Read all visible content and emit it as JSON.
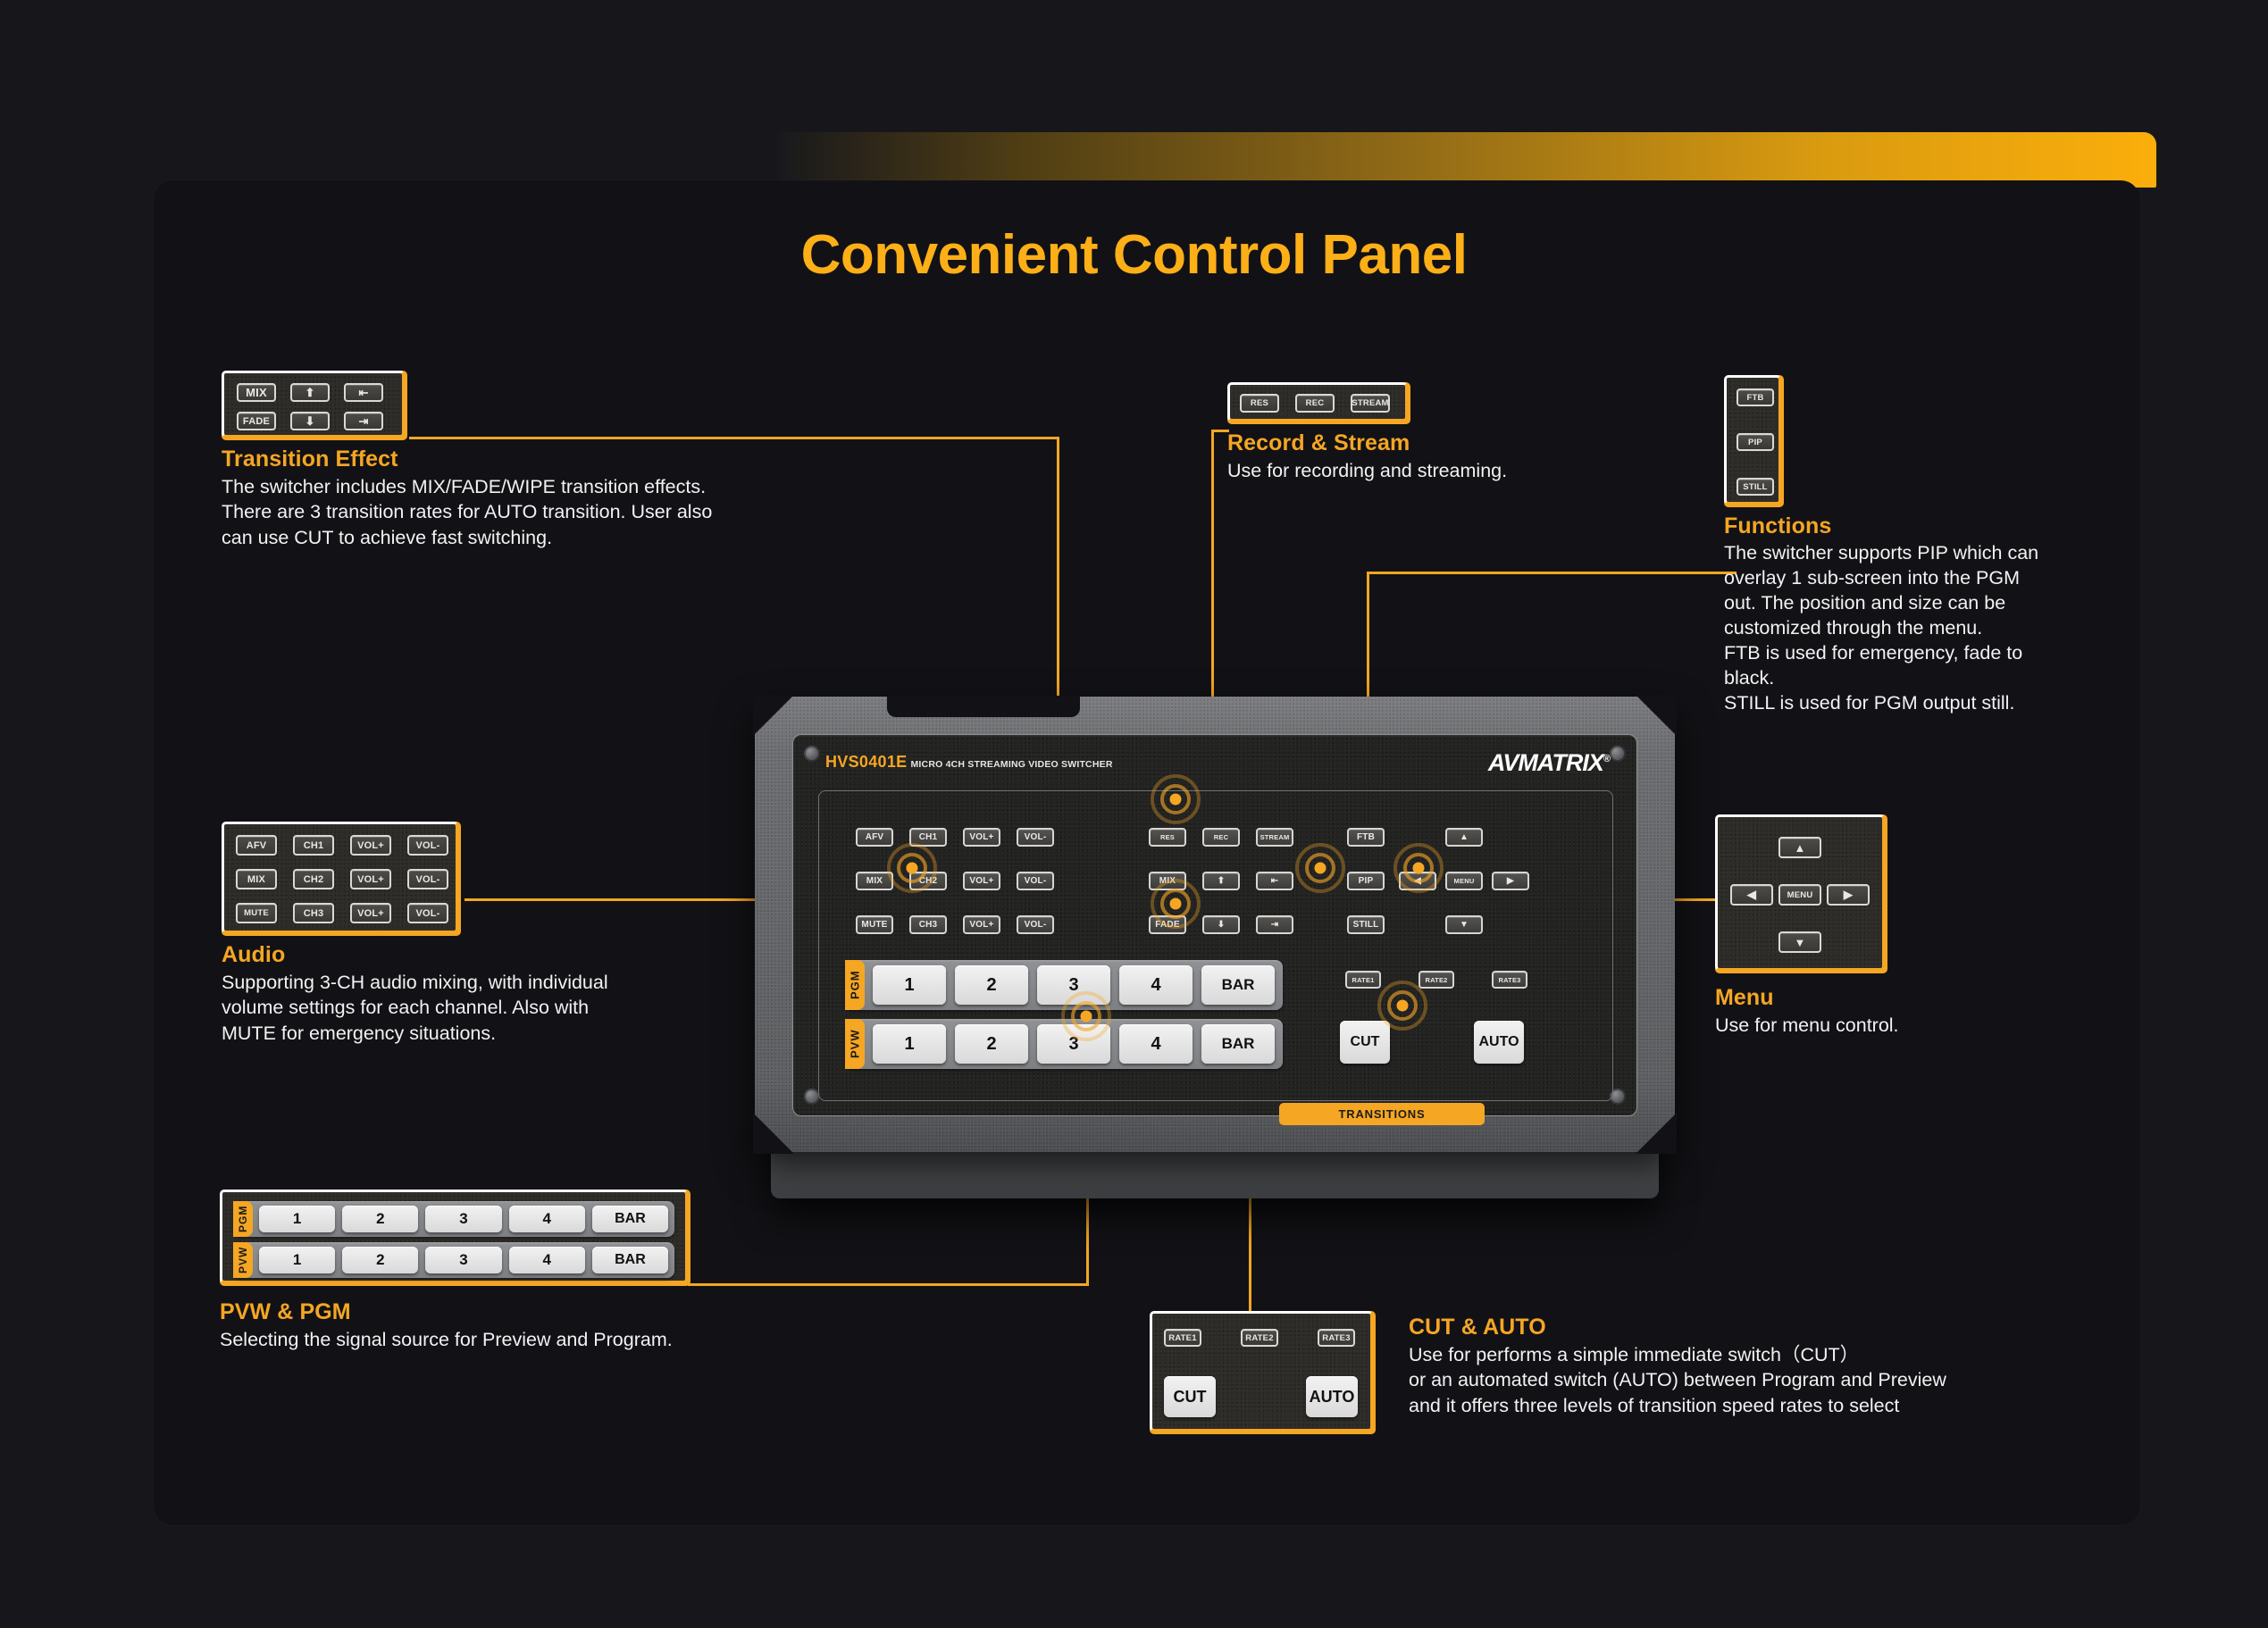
{
  "page": {
    "title": "Convenient Control Panel",
    "accent": "#F5A623",
    "title_color": "#FCAF17",
    "background": "#17171b",
    "card_background": "#121216"
  },
  "device": {
    "model": "HVS0401E",
    "model_subtitle": "MICRO 4CH STREAMING VIDEO SWITCHER",
    "brand": "AVMATRIX",
    "brand_trademark": "®",
    "transitions_label": "TRANSITIONS",
    "audio_rows": [
      [
        "AFV",
        "CH1",
        "VOL+",
        "VOL-"
      ],
      [
        "MIX",
        "CH2",
        "VOL+",
        "VOL-"
      ],
      [
        "MUTE",
        "CH3",
        "VOL+",
        "VOL-"
      ]
    ],
    "record_row": [
      "RES",
      "REC",
      "STREAM"
    ],
    "transition_rows": [
      [
        "MIX",
        "⬆",
        "⇤"
      ],
      [
        "FADE",
        "⬇",
        "⇥"
      ]
    ],
    "function_column": [
      "FTB",
      "PIP",
      "STILL"
    ],
    "menu_keys": {
      "up": "▲",
      "left": "◀",
      "center": "MENU",
      "right": "▶",
      "down": "▼"
    },
    "rate_keys": [
      "RATE1",
      "RATE2",
      "RATE3"
    ],
    "cut_label": "CUT",
    "auto_label": "AUTO",
    "pgm_tag": "PGM",
    "pvw_tag": "PVW",
    "source_keys": [
      "1",
      "2",
      "3",
      "4",
      "BAR"
    ]
  },
  "callouts": {
    "transition_effect": {
      "title": "Transition Effect",
      "body": "The switcher includes MIX/FADE/WIPE transition effects. There are 3 transition rates for AUTO transition. User also can use CUT to achieve fast switching.",
      "lines": [
        "The switcher includes MIX/FADE/WIPE transition effects.",
        "There are 3 transition rates for AUTO transition. User also",
        "can use CUT to achieve fast switching."
      ],
      "keys_row1": [
        "MIX",
        "⬆",
        "⇤"
      ],
      "keys_row2": [
        "FADE",
        "⬇",
        "⇥"
      ]
    },
    "audio": {
      "title": "Audio",
      "lines": [
        "Supporting 3-CH audio mixing, with individual",
        "volume settings for each channel. Also with",
        "MUTE for emergency situations."
      ],
      "keys": [
        [
          "AFV",
          "CH1",
          "VOL+",
          "VOL-"
        ],
        [
          "MIX",
          "CH2",
          "VOL+",
          "VOL-"
        ],
        [
          "MUTE",
          "CH3",
          "VOL+",
          "VOL-"
        ]
      ]
    },
    "pvw_pgm": {
      "title": "PVW & PGM",
      "lines": [
        "Selecting the signal source for Preview and Program."
      ],
      "pgm_tag": "PGM",
      "pvw_tag": "PVW",
      "keys": [
        "1",
        "2",
        "3",
        "4",
        "BAR"
      ]
    },
    "record_stream": {
      "title": "Record & Stream",
      "lines": [
        "Use for recording and streaming."
      ],
      "keys": [
        "RES",
        "REC",
        "STREAM"
      ]
    },
    "functions": {
      "title": "Functions",
      "lines": [
        "The switcher supports PIP which can",
        "overlay 1 sub-screen into the PGM",
        "out. The position and size can be",
        "customized through the menu.",
        "FTB is used for emergency, fade to",
        "black.",
        "STILL is used for PGM output still."
      ],
      "keys": [
        "FTB",
        "PIP",
        "STILL"
      ]
    },
    "menu": {
      "title": "Menu",
      "lines": [
        "Use for menu control."
      ],
      "keys": {
        "up": "▲",
        "left": "◀",
        "center": "MENU",
        "right": "▶",
        "down": "▼"
      }
    },
    "cut_auto": {
      "title": "CUT & AUTO",
      "lines": [
        "Use for performs a simple immediate switch（CUT）",
        "or an automated switch (AUTO) between Program and Preview",
        "and it offers three levels of transition speed rates to select"
      ],
      "rate_keys": [
        "RATE1",
        "RATE2",
        "RATE3"
      ],
      "cut_label": "CUT",
      "auto_label": "AUTO"
    }
  }
}
